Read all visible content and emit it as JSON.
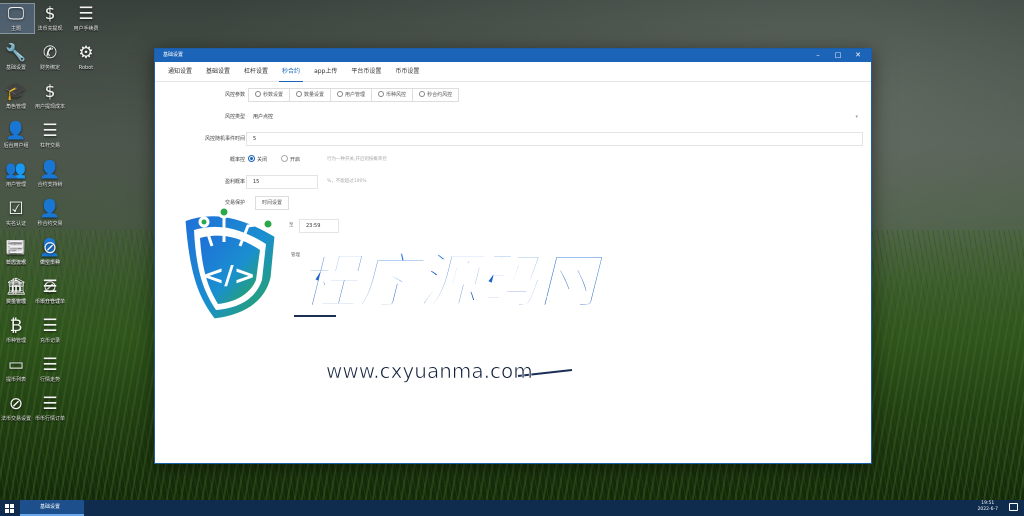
{
  "desktop": {
    "icons": [
      {
        "label": "主题",
        "glyph": "🖵",
        "icon": "monitor-icon"
      },
      {
        "label": "法币充提现",
        "glyph": "$",
        "icon": "dollar-icon"
      },
      {
        "label": "用户手续费",
        "glyph": "☰",
        "icon": "list-icon"
      },
      {
        "label": "基础设置",
        "glyph": "🔧",
        "icon": "wrench-icon"
      },
      {
        "label": "财务绑定",
        "glyph": "✆",
        "icon": "phone-icon"
      },
      {
        "label": "Robot",
        "glyph": "⚙",
        "icon": "robot-icon"
      },
      {
        "label": "角色管理",
        "glyph": "🎓",
        "icon": "graduation-cap-icon"
      },
      {
        "label": "用户提现成本",
        "glyph": "$",
        "icon": "dollar-icon"
      },
      {
        "label": "后台用户组",
        "glyph": "👤",
        "icon": "user-circle-icon"
      },
      {
        "label": "杠杆交易",
        "glyph": "☰",
        "icon": "list-icon"
      },
      {
        "label": "用户管理",
        "glyph": "👥",
        "icon": "users-icon"
      },
      {
        "label": "合约支持树",
        "glyph": "👤",
        "icon": "user-plus-icon"
      },
      {
        "label": "实名认证",
        "glyph": "☑",
        "icon": "check-square-icon"
      },
      {
        "label": "秒合约交易",
        "glyph": "👤",
        "icon": "user-plus-icon"
      },
      {
        "label": "新闻管理",
        "glyph": "📰",
        "icon": "newspaper-icon"
      },
      {
        "label": "币币交易",
        "glyph": "👤",
        "icon": "user-plus-icon"
      },
      {
        "label": "转币审核",
        "glyph": "₿",
        "icon": "bitcoin-icon"
      },
      {
        "label": "锁仓管理",
        "glyph": "⊘",
        "icon": "link-circle-icon"
      },
      {
        "label": "日志流水",
        "glyph": "☰",
        "icon": "list-icon"
      },
      {
        "label": "做空币种",
        "glyph": "⊘",
        "icon": "link-circle-icon"
      },
      {
        "label": "资金管理",
        "glyph": "🏛",
        "icon": "bank-icon"
      },
      {
        "label": "币币开仓订单",
        "glyph": "☰",
        "icon": "list-icon"
      },
      {
        "label": "币种管理",
        "glyph": "₿",
        "icon": "bitcoin-icon"
      },
      {
        "label": "充币记录",
        "glyph": "☰",
        "icon": "list-icon"
      },
      {
        "label": "提币列表",
        "glyph": "▭",
        "icon": "card-icon"
      },
      {
        "label": "行情走势",
        "glyph": "☰",
        "icon": "list-icon"
      },
      {
        "label": "法币交易设置",
        "glyph": "⊘",
        "icon": "link-circle-icon"
      },
      {
        "label": "币币行情订单",
        "glyph": "☰",
        "icon": "list-icon"
      }
    ]
  },
  "window": {
    "title": "基础设置",
    "controls": {
      "minimize": "–",
      "maximize": "□",
      "close": "✕"
    },
    "tabs": [
      "通知设置",
      "基础设置",
      "杠杆设置",
      "秒合约",
      "app上传",
      "平台币设置",
      "币币设置"
    ],
    "active_tab": 3,
    "form": {
      "risk_type_label": "风控参数",
      "risk_type_options": [
        "秒数设置",
        "数量设置",
        "用户管理",
        "币种风控",
        "秒合约风控"
      ],
      "risk_mode_label": "风控类型",
      "risk_mode_value": "用户点控",
      "delay_label": "风控随机事件时间",
      "delay_value": "5",
      "switch_label": "概率控",
      "switch_off": "关闭",
      "switch_on": "开启",
      "switch_hint": "行为一种开关,开启则按概率控",
      "profit_label": "盈利概率",
      "profit_value": "15",
      "profit_hint": "%，不能超过100%",
      "trade_protect_label": "交易保护",
      "trade_protect_button": "时间设置",
      "time_value": "23:59",
      "time_sep": "至",
      "manage_link": "管理"
    }
  },
  "watermark": {
    "title": "程序源码网",
    "url": "www.cxyuanma.com",
    "logo_mark": "</>"
  },
  "taskbar": {
    "app_label": "基础设置",
    "time": "19:51",
    "date": "2022-6-7"
  }
}
